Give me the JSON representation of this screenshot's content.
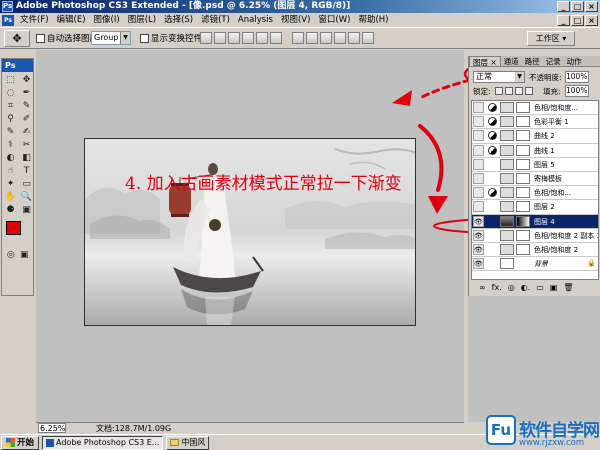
{
  "titlebar": {
    "app_badge": "Ps",
    "title": "Adobe Photoshop CS3 Extended - [像.psd @ 6.25% (图层 4, RGB/8)]",
    "buttons": [
      "_",
      "□",
      "×"
    ]
  },
  "menubar": {
    "ps_label": "Ps",
    "items": [
      "文件(F)",
      "编辑(E)",
      "图像(I)",
      "图层(L)",
      "选择(S)",
      "滤镜(T)",
      "Analysis",
      "视图(V)",
      "窗口(W)",
      "帮助(H)"
    ],
    "doc_buttons": [
      "_",
      "□",
      "×"
    ]
  },
  "optionsbar": {
    "tool_glyph": "✥",
    "auto_select_label": "自动选择图层",
    "auto_select_value": "Group",
    "show_transform_label": "显示变换控件",
    "workspace_label": "工作区 ▾"
  },
  "toolbox": {
    "logo": "Ps",
    "tools": [
      "⬚",
      "✥",
      "◌",
      "✒",
      "⌗",
      "✎",
      "⚲",
      "✐",
      "✎",
      "✍",
      "⚕",
      "✂",
      "◐",
      "◧",
      "☝",
      "T",
      "✦",
      "▭",
      "✋",
      "🔍",
      "⚈",
      "▣"
    ],
    "fg_color": "#e20000",
    "bg_color": "#ffffff"
  },
  "annotation": {
    "text": "4. 加入古画素材模式正常拉一下渐变",
    "color": "#e00010"
  },
  "statusbar": {
    "zoom": "6.25%",
    "doc_info": "文档:128.7M/1.09G"
  },
  "layers_panel": {
    "tabs": [
      "图层 ×",
      "通道",
      "路径",
      "记录",
      "动作"
    ],
    "blend_mode": "正常",
    "opacity_label": "不透明度:",
    "opacity_value": "100%",
    "lock_label": "锁定:",
    "fill_label": "填充:",
    "fill_value": "100%",
    "layers": [
      {
        "name": "色相/饱和度...",
        "type": "adjustment",
        "selected": false,
        "visible": false
      },
      {
        "name": "色彩平衡 1",
        "type": "adjustment",
        "selected": false,
        "visible": false
      },
      {
        "name": "曲线 2",
        "type": "adjustment",
        "selected": false,
        "visible": false
      },
      {
        "name": "曲线 1",
        "type": "adjustment",
        "selected": false,
        "visible": false
      },
      {
        "name": "图层 5",
        "type": "pixel",
        "selected": false,
        "visible": false
      },
      {
        "name": "寄梅模板",
        "type": "pixel",
        "selected": false,
        "visible": false
      },
      {
        "name": "色相/饱和...",
        "type": "adjustment",
        "selected": false,
        "visible": false
      },
      {
        "name": "图层 2",
        "type": "pixel",
        "selected": false,
        "visible": false
      },
      {
        "name": "图层 4",
        "type": "pixel",
        "selected": true,
        "visible": true
      },
      {
        "name": "色相/饱和度 2 副本 3",
        "type": "pixel",
        "selected": false,
        "visible": true
      },
      {
        "name": "色相/饱和度 2",
        "type": "pixel",
        "selected": false,
        "visible": true
      },
      {
        "name": "背景",
        "type": "background",
        "selected": false,
        "visible": true
      }
    ],
    "footer_icons": [
      "∞",
      "fx.",
      "◎",
      "◐.",
      "▭",
      "▣",
      "🗑"
    ]
  },
  "taskbar": {
    "start_label": "开始",
    "tasks": [
      "Adobe Photoshop CS3 E...",
      "中国风"
    ]
  },
  "watermark": {
    "logo": "Fu",
    "title": "软件自学网",
    "url": "www.rjzxw.com"
  }
}
